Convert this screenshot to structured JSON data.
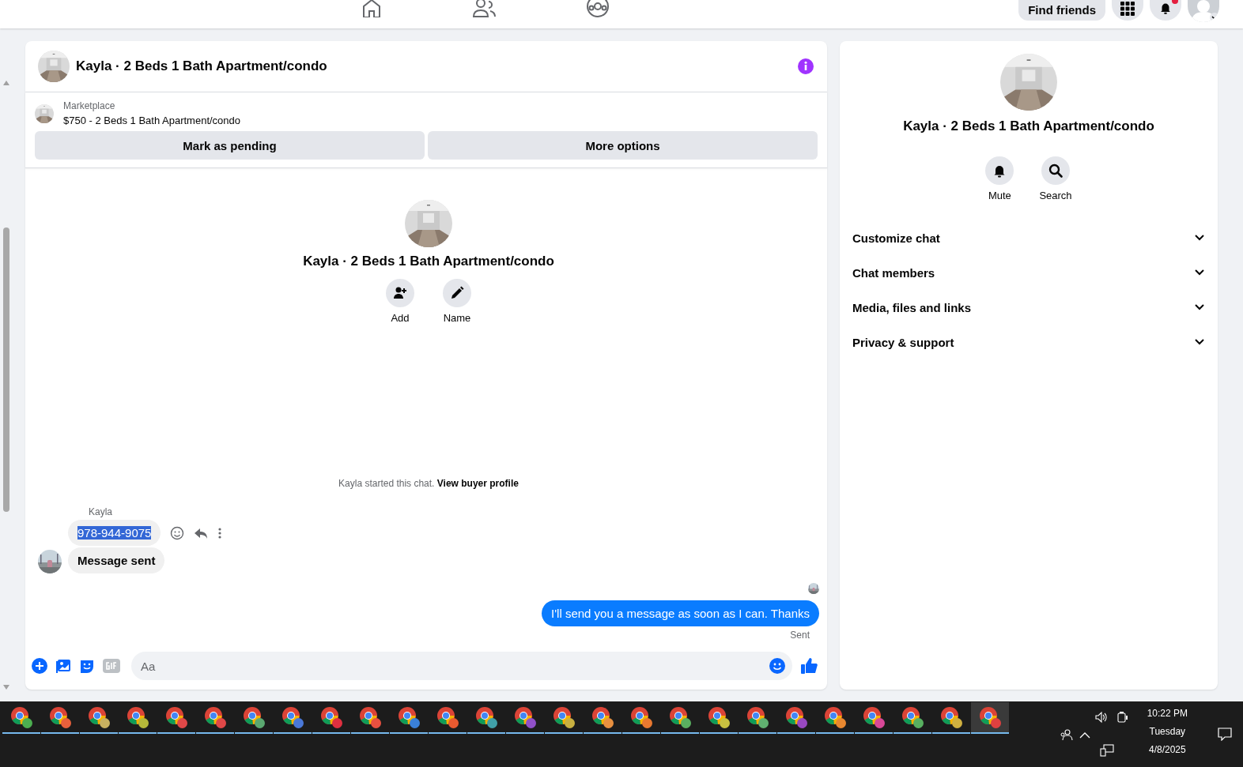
{
  "top_bar": {
    "find_friends": "Find friends",
    "notifications_unread": true
  },
  "chat": {
    "title": "Kayla · 2 Beds 1 Bath Apartment/condo",
    "listing": {
      "source": "Marketplace",
      "title": "$750 - 2 Beds 1 Bath Apartment/condo"
    },
    "actions": [
      "Mark as pending",
      "More options"
    ],
    "intro": {
      "title": "Kayla · 2 Beds 1 Bath Apartment/condo",
      "actions": [
        {
          "kind": "add",
          "label": "Add"
        },
        {
          "kind": "edit",
          "label": "Name"
        }
      ]
    },
    "started": {
      "text": "Kayla started this chat.",
      "link": "View buyer profile"
    },
    "messages": [
      {
        "kind": "incoming",
        "sender": "Kayla",
        "text": "978-944-9075",
        "highlighted": true
      },
      {
        "kind": "incoming",
        "text": "Message sent",
        "highlighted": false
      },
      {
        "kind": "outgoing",
        "text": "I'll send you a message as soon as I can. Thanks",
        "status": "Sent"
      }
    ],
    "composer": {
      "placeholder": "Aa"
    }
  },
  "info_panel": {
    "title": "Kayla · 2 Beds 1 Bath Apartment/condo",
    "actions": [
      {
        "kind": "mute",
        "label": "Mute"
      },
      {
        "kind": "search",
        "label": "Search"
      }
    ],
    "sections": [
      {
        "label": "Customize chat",
        "expanded": false
      },
      {
        "label": "Chat members",
        "expanded": false
      },
      {
        "label": "Media, files and links",
        "expanded": false
      },
      {
        "label": "Privacy & support",
        "expanded": false
      }
    ]
  },
  "taskbar": {
    "apps": [
      {
        "color": "#4caf50",
        "selected": false
      },
      {
        "color": "#e8603c",
        "selected": false
      },
      {
        "color": "#c8b060",
        "selected": false
      },
      {
        "color": "#b5b83a",
        "selected": false
      },
      {
        "color": "#e04848",
        "selected": false
      },
      {
        "color": "#e04848",
        "selected": false
      },
      {
        "color": "#5aa870",
        "selected": false
      },
      {
        "color": "#4a78d8",
        "selected": false
      },
      {
        "color": "#e03040",
        "selected": false
      },
      {
        "color": "#e85040",
        "selected": false
      },
      {
        "color": "#3a80d8",
        "selected": false
      },
      {
        "color": "#e85a30",
        "selected": false
      },
      {
        "color": "#40a0a8",
        "selected": false
      },
      {
        "color": "#9050c8",
        "selected": false
      },
      {
        "color": "#c8b040",
        "selected": false
      },
      {
        "color": "#e89040",
        "selected": false
      },
      {
        "color": "#e87830",
        "selected": false
      },
      {
        "color": "#5ab060",
        "selected": false
      },
      {
        "color": "#c8c040",
        "selected": false
      },
      {
        "color": "#60b070",
        "selected": false
      },
      {
        "color": "#9848c0",
        "selected": false
      },
      {
        "color": "#e88830",
        "selected": false
      },
      {
        "color": "#d84898",
        "selected": false
      },
      {
        "color": "#58b060",
        "selected": false
      },
      {
        "color": "#d0b040",
        "selected": false
      },
      {
        "color": "#e04040",
        "selected": true
      }
    ],
    "clock": {
      "time": "10:22 PM",
      "day": "Tuesday",
      "date": "4/8/2025"
    }
  }
}
